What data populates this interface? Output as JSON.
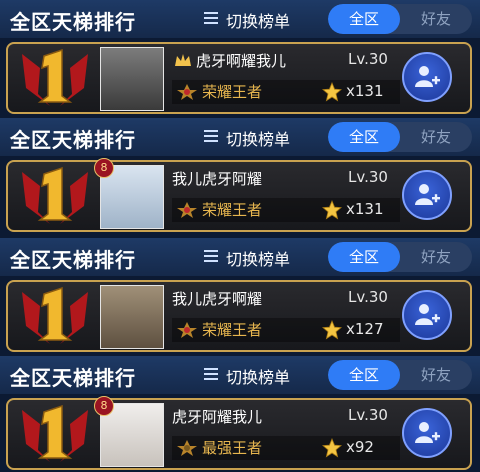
{
  "header": {
    "title": "全区天梯排行",
    "switch_label": "切换榜单",
    "tabs": [
      "全区",
      "好友"
    ]
  },
  "rows": [
    {
      "name": "虎牙啊耀我儿",
      "level": "Lv.30",
      "rank_title": "荣耀王者",
      "stars": "x131",
      "crown": true,
      "level_chip": ""
    },
    {
      "name": "我儿虎牙阿耀",
      "level": "Lv.30",
      "rank_title": "荣耀王者",
      "stars": "x131",
      "crown": false,
      "level_chip": "8"
    },
    {
      "name": "我儿虎牙啊耀",
      "level": "Lv.30",
      "rank_title": "荣耀王者",
      "stars": "x127",
      "crown": false,
      "level_chip": ""
    },
    {
      "name": "虎牙阿耀我儿",
      "level": "Lv.30",
      "rank_title": "最强王者",
      "stars": "x92",
      "crown": false,
      "level_chip": "8"
    }
  ],
  "colors": {
    "accent": "#2f7cf6",
    "card_border": "#c9a250",
    "rank_gold": "#e7b64f",
    "divider_red": "#c81e2e"
  },
  "icons": [
    "list-icon",
    "rank-one-badge",
    "crown-icon",
    "rank-emblem-icon",
    "star-icon",
    "add-friend-icon"
  ]
}
